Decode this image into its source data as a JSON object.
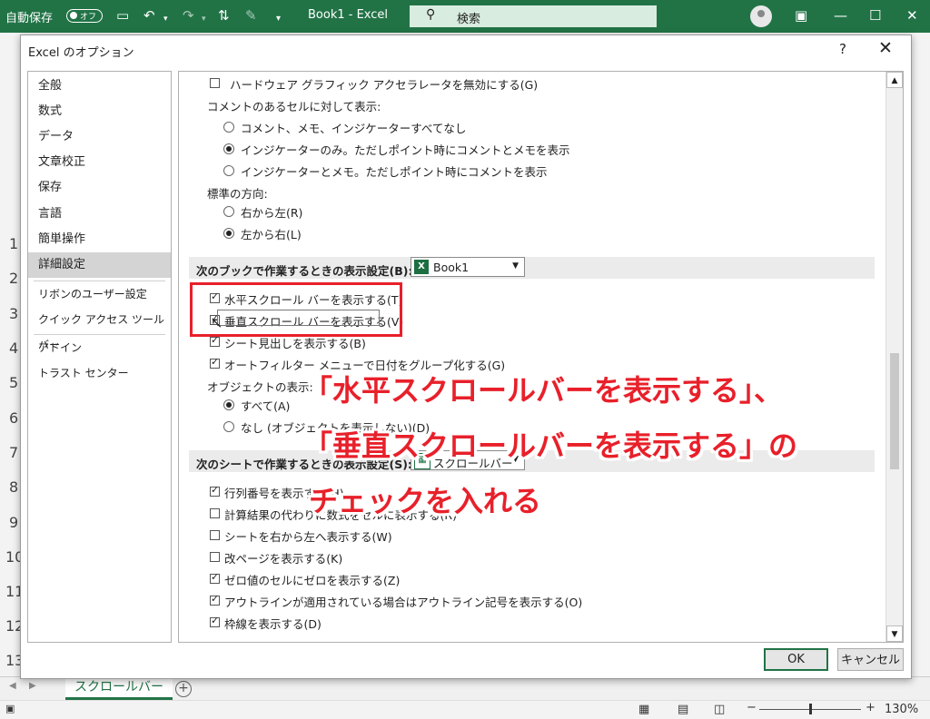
{
  "titlebar": {
    "autosave_label": "自動保存",
    "autosave_state": "オフ",
    "file_title": "Book1  -  Excel",
    "search_placeholder": "検索"
  },
  "background": {
    "row_numbers": [
      "1",
      "2",
      "3",
      "4",
      "5",
      "6",
      "7",
      "8",
      "9",
      "10",
      "11",
      "12",
      "13"
    ],
    "sheet_tab": "スクロールバー",
    "zoom": "130%"
  },
  "dialog": {
    "title": "Excel のオプション",
    "help": "?",
    "close": "✕",
    "nav": [
      "全般",
      "数式",
      "データ",
      "文章校正",
      "保存",
      "言語",
      "簡単操作",
      "詳細設定",
      "リボンのユーザー設定",
      "クイック アクセス ツール バー",
      "アドイン",
      "トラスト センター"
    ],
    "selected_nav": "詳細設定",
    "options": {
      "hw_graphics": "ハードウェア グラフィック アクセラレータを無効にする(G)",
      "comment_heading": "コメントのあるセルに対して表示:",
      "comment_opt1": "コメント、メモ、インジケーターすべてなし",
      "comment_opt2": "インジケーターのみ。ただしポイント時にコメントとメモを表示",
      "comment_opt3": "インジケーターとメモ。ただしポイント時にコメントを表示",
      "direction_heading": "標準の方向:",
      "dir_rtl": "右から左(R)",
      "dir_ltr": "左から右(L)",
      "book_section": "次のブックで作業するときの表示設定(B):",
      "book_value": "Book1",
      "hscroll": "水平スクロール バーを表示する(T)",
      "vscroll": "垂直スクロール バーを表示する(V)",
      "sheet_tabs": "シート見出しを表示する(B)",
      "autofilter_group": "オートフィルター メニューで日付をグループ化する(G)",
      "objects_heading": "オブジェクトの表示:",
      "obj_all": "すべて(A)",
      "obj_none": "なし (オブジェクトを表示しない)(D)",
      "sheet_section": "次のシートで作業するときの表示設定(S):",
      "sheet_value": "スクロールバー",
      "row_col_headers": "行列番号を表示する(H)",
      "formulas": "計算結果の代わりに数式をセルに表示する(R)",
      "rtl_sheet": "シートを右から左へ表示する(W)",
      "page_breaks": "改ページを表示する(K)",
      "zero_values": "ゼロ値のセルにゼロを表示する(Z)",
      "outline_symbols": "アウトラインが適用されている場合はアウトライン記号を表示する(O)",
      "gridlines": "枠線を表示する(D)"
    },
    "ok": "OK",
    "cancel": "キャンセル"
  },
  "annotation": {
    "line1": "「水平スクロールバーを表示する」、",
    "line2": "「垂直スクロールバーを表示する」の",
    "line3": "チェックを入れる",
    "color": "#e8202a"
  },
  "accent_color": "#217346"
}
